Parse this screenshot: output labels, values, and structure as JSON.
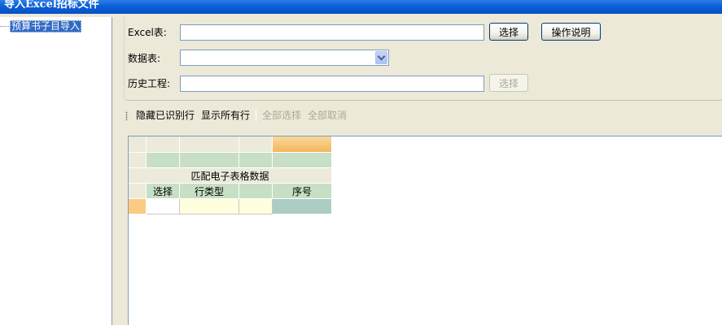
{
  "window": {
    "title": "导入Excel招标文件"
  },
  "tree": {
    "items": [
      {
        "label": "预算书子目导入"
      }
    ]
  },
  "form": {
    "excel_label": "Excel表:",
    "excel_value": "",
    "excel_select_button": "选择",
    "help_button": "操作说明",
    "sheet_label": "数据表:",
    "sheet_value": "",
    "history_label": "历史工程:",
    "history_value": "",
    "history_select_button": "选择"
  },
  "toolbar": {
    "hide_recognized": "隐藏已识别行",
    "show_all": "显示所有行",
    "select_all": "全部选择",
    "deselect_all": "全部取消"
  },
  "grid": {
    "group_header": "匹配电子表格数据",
    "columns": [
      "选择",
      "行类型",
      "",
      "序号"
    ]
  },
  "colors": {
    "title_bar": "#0a5fd8",
    "tree_selection": "#316ac5",
    "header_green": "#c7dfc4",
    "header_gray": "#ebeadb",
    "selected_header": "#f3b55c",
    "row_yellow": "#ffffdd",
    "row_teal": "#abcdc4"
  }
}
